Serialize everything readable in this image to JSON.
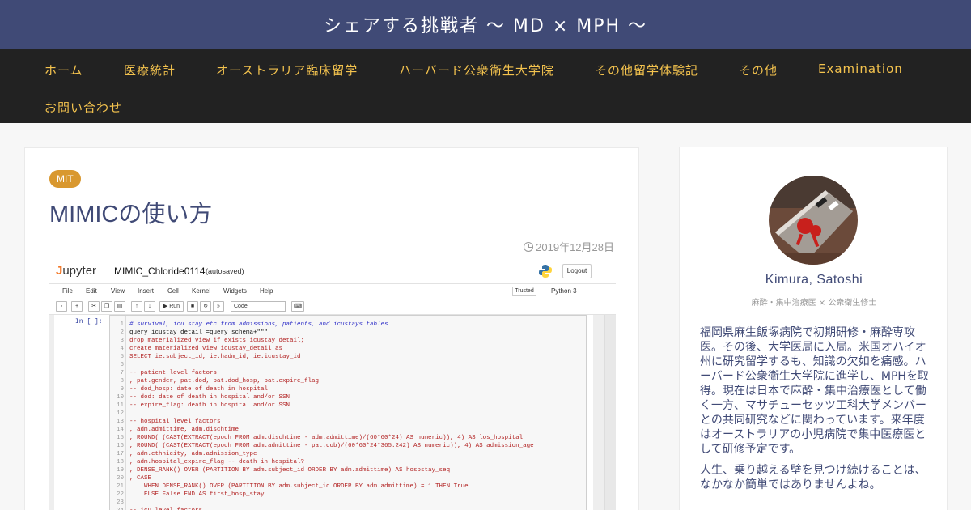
{
  "site": {
    "title": "シェアする挑戦者 〜 MD × MPH 〜"
  },
  "nav": {
    "items": [
      {
        "label": "ホーム"
      },
      {
        "label": "医療統計"
      },
      {
        "label": "オーストラリア臨床留学"
      },
      {
        "label": "ハーバード公衆衛生大学院"
      },
      {
        "label": "その他留学体験記"
      },
      {
        "label": "その他"
      },
      {
        "label": "Examination"
      },
      {
        "label": "お問い合わせ"
      }
    ]
  },
  "post": {
    "category": "MIT",
    "title": "MIMICの使い方",
    "date": "2019年12月28日"
  },
  "thumbnail": {
    "app_name": "upyter",
    "app_name_initial": "J",
    "notebook_name": "MIMIC_Chloride0114",
    "save_status": "(autosaved)",
    "logout_label": "Logout",
    "menu": [
      "File",
      "Edit",
      "View",
      "Insert",
      "Cell",
      "Kernel",
      "Widgets",
      "Help"
    ],
    "trusted_label": "Trusted",
    "kernel_label": "Python 3",
    "toolbar": {
      "run_label": "▶ Run",
      "cell_type": "Code"
    },
    "prompt": "In [ ]:",
    "code_lines": [
      {
        "n": "1",
        "text": "# survival, icu stay etc from admissions, patients, and icustays tables",
        "style": "comment"
      },
      {
        "n": "2",
        "text": "query_icustay_detail =query_schema+\"\"\"",
        "style": "black"
      },
      {
        "n": "3",
        "text": "drop materialized view if exists icustay_detail;",
        "style": "red"
      },
      {
        "n": "4",
        "text": "create materialized view icustay_detail as",
        "style": "red"
      },
      {
        "n": "5",
        "text": "SELECT ie.subject_id, ie.hadm_id, ie.icustay_id",
        "style": "red"
      },
      {
        "n": "6",
        "text": "",
        "style": "red"
      },
      {
        "n": "7",
        "text": "-- patient level factors",
        "style": "red"
      },
      {
        "n": "8",
        "text": ", pat.gender, pat.dod, pat.dod_hosp, pat.expire_flag",
        "style": "red"
      },
      {
        "n": "9",
        "text": "-- dod_hosp: date of death in hospital",
        "style": "red"
      },
      {
        "n": "10",
        "text": "-- dod: date of death in hospital and/or SSN",
        "style": "red"
      },
      {
        "n": "11",
        "text": "-- expire_flag: death in hospital and/or SSN",
        "style": "red"
      },
      {
        "n": "12",
        "text": "",
        "style": "red"
      },
      {
        "n": "13",
        "text": "-- hospital level factors",
        "style": "red"
      },
      {
        "n": "14",
        "text": ", adm.admittime, adm.dischtime",
        "style": "red"
      },
      {
        "n": "15",
        "text": ", ROUND( (CAST(EXTRACT(epoch FROM adm.dischtime - adm.admittime)/(60*60*24) AS numeric)), 4) AS los_hospital",
        "style": "red"
      },
      {
        "n": "16",
        "text": ", ROUND( (CAST(EXTRACT(epoch FROM adm.admittime - pat.dob)/(60*60*24*365.242) AS numeric)), 4) AS admission_age",
        "style": "red"
      },
      {
        "n": "17",
        "text": ", adm.ethnicity, adm.admission_type",
        "style": "red"
      },
      {
        "n": "18",
        "text": ", adm.hospital_expire_flag -- death in hospital?",
        "style": "red"
      },
      {
        "n": "19",
        "text": ", DENSE_RANK() OVER (PARTITION BY adm.subject_id ORDER BY adm.admittime) AS hospstay_seq",
        "style": "red"
      },
      {
        "n": "20",
        "text": ", CASE",
        "style": "red"
      },
      {
        "n": "21",
        "text": "    WHEN DENSE_RANK() OVER (PARTITION BY adm.subject_id ORDER BY adm.admittime) = 1 THEN True",
        "style": "red"
      },
      {
        "n": "22",
        "text": "    ELSE False END AS first_hosp_stay",
        "style": "red"
      },
      {
        "n": "23",
        "text": "",
        "style": "red"
      },
      {
        "n": "24",
        "text": "-- icu level factors",
        "style": "red"
      }
    ]
  },
  "author": {
    "name": "Kimura, Satoshi",
    "role": "麻酔・集中治療医 × 公衆衛生修士",
    "bio": [
      "福岡県麻生飯塚病院で初期研修・麻酔専攻医。その後、大学医局に入局。米国オハイオ州に研究留学するも、知識の欠如を痛感。ハーバード公衆衛生大学院に進学し、MPHを取得。現在は日本で麻酔・集中治療医として働く一方、マサチューセッツ工科大学メンバーとの共同研究などに関わっています。来年度はオーストラリアの小児病院で集中医療医として研修予定です。",
      "人生、乗り越える壁を見つけ続けることは、なかなか簡単ではありませんよね。"
    ]
  },
  "colors": {
    "header_bg": "#404a76",
    "nav_bg": "#222222",
    "nav_text": "#f4c34e",
    "badge": "#d9982f",
    "title_text": "#404a76"
  }
}
